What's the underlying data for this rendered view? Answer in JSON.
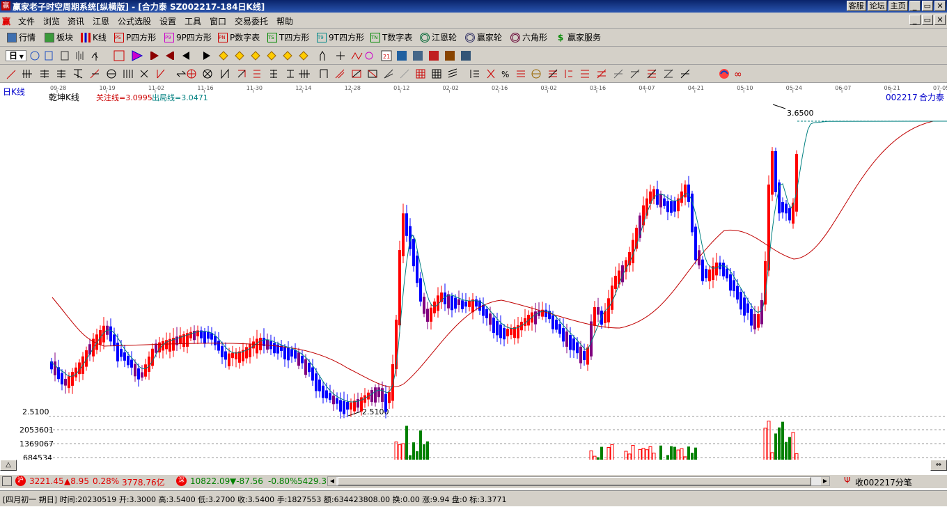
{
  "window": {
    "title": "赢家老子时空周期系统[纵横版] - [合力泰  SZ002217-184日K线]",
    "app_icon": "赢",
    "buttons": [
      "客服",
      "论坛",
      "主页",
      "_",
      "▭",
      "✕"
    ]
  },
  "menu": {
    "icon": "赢",
    "items": [
      "文件",
      "浏览",
      "资讯",
      "江恩",
      "公式选股",
      "设置",
      "工具",
      "窗口",
      "交易委托",
      "帮助"
    ],
    "mdi_buttons": [
      "_",
      "▭",
      "✕"
    ]
  },
  "toolbar1": {
    "items": [
      {
        "label": "行情",
        "icon": "grid-icon"
      },
      {
        "label": "板块",
        "icon": "grid-icon"
      },
      {
        "label": "K线",
        "icon": "candle-icon"
      },
      {
        "label": "P四方形",
        "icon": "ps-icon",
        "badge": "PS"
      },
      {
        "label": "9P四方形",
        "icon": "p9-icon",
        "badge": "P9"
      },
      {
        "label": "P数字表",
        "icon": "pn-icon",
        "badge": "PN"
      },
      {
        "label": "T四方形",
        "icon": "ts-icon",
        "badge": "TS"
      },
      {
        "label": "9T四方形",
        "icon": "t9-icon",
        "badge": "T9"
      },
      {
        "label": "T数字表",
        "icon": "tn-icon",
        "badge": "TN"
      },
      {
        "label": "江恩轮",
        "icon": "wheel-icon"
      },
      {
        "label": "赢家轮",
        "icon": "wheel-icon"
      },
      {
        "label": "六角形",
        "icon": "hexagon-icon"
      },
      {
        "label": "赢家服务",
        "icon": "dollar-icon"
      }
    ]
  },
  "toolbar2": {
    "period": "日"
  },
  "chart": {
    "period_label": "日K线",
    "indicator_name": "乾坤K线",
    "focus_line": "关注线=3.0995",
    "exit_line": "出局线=3.0471",
    "code_label": "002217",
    "stock_name": "合力泰",
    "high_label": "3.6500",
    "low_label": "2.5100",
    "left_price": "2.5100",
    "vol_labels": [
      "2053601",
      "1369067",
      "684534"
    ],
    "dates": [
      "09-28",
      "10-19",
      "11-02",
      "11-16",
      "11-30",
      "12-14",
      "12-28",
      "01-12",
      "02-02",
      "02-16",
      "03-02",
      "03-16",
      "04-07",
      "04-21",
      "05-10",
      "05-24",
      "06-07",
      "06-21",
      "07-05"
    ],
    "colors": {
      "up": "#ff0000",
      "down": "#0000ff",
      "neutral": "#800080",
      "flat": "#008000",
      "ma_short": "#008080",
      "ma_long": "#c00000",
      "volume_up": "#ff0000",
      "volume_down": "#008000"
    }
  },
  "status": {
    "sh_badge": "沪",
    "sh_index": "3221.45",
    "sh_change": "▲8.95",
    "sh_pct": "0.28%",
    "sh_amount": "3778.76亿",
    "sz_badge": "深",
    "sz_index": "10822.09",
    "sz_change": "▼-87.56",
    "sz_pct": "-0.80%",
    "sz_amount": "5429.3",
    "tick_label": "收002217分笔"
  },
  "info": {
    "lunar": "[四月初一  朔日]",
    "time_label": "时间",
    "time": "20230519",
    "open_label": "开",
    "open": "3.3000",
    "high_label": "高",
    "high": "3.5400",
    "low_label": "低",
    "low": "3.2700",
    "close_label": "收",
    "close": "3.5400",
    "hand_label": "手",
    "hand": "1827553",
    "amount_label": "额",
    "amount": "634423808.00",
    "turnover_label": "换",
    "turnover": "0.00",
    "rise_label": "涨",
    "rise": "9.94",
    "position_label": "盘",
    "position": "0",
    "mark_label": "标",
    "mark": "3.3771"
  }
}
